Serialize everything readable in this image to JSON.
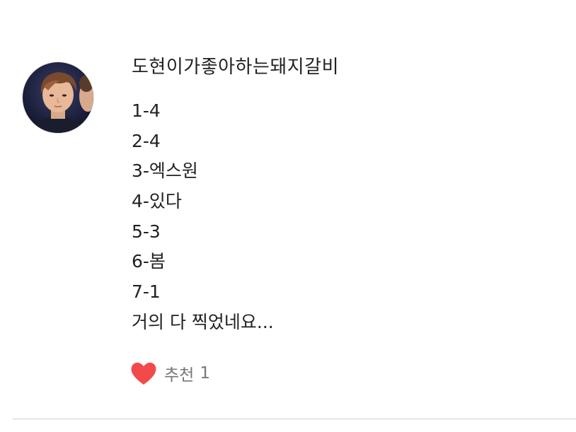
{
  "comment": {
    "author": "도현이가좋아하는돼지갈비",
    "lines": [
      "1-4",
      "2-4",
      "3-엑스원",
      "4-있다",
      "5-3",
      "6-봄",
      "7-1",
      "거의 다 찍었네요..."
    ],
    "recommend": {
      "label": "추천",
      "count": "1"
    }
  },
  "colors": {
    "heart": "#f24a4a",
    "text": "#222222",
    "muted": "#777777",
    "divider": "#ebebeb"
  },
  "icons": {
    "recommend": "heart-icon"
  }
}
